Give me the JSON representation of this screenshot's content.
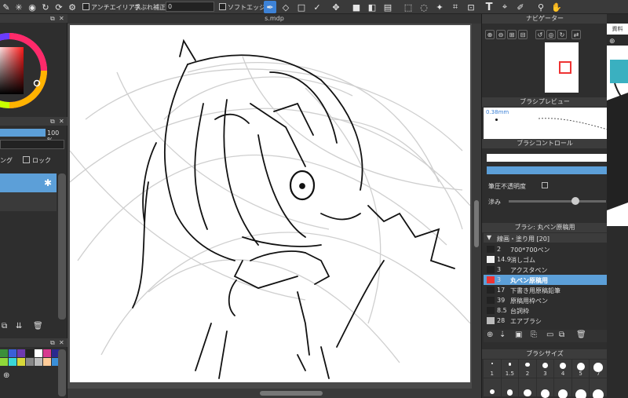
{
  "toolbar": {
    "antialias_label": "アンチエイリアス",
    "stabilizer_label": "手ぶれ補正",
    "stabilizer_value": "0",
    "soft_edge_label": "ソフトエッジ",
    "text_tool_glyph": "T"
  },
  "layer_panel": {
    "opacity_value": "100 %",
    "clipping_label": "ング",
    "lock_label": "ロック"
  },
  "document": {
    "tab_title": "s.mdp"
  },
  "navigator": {
    "title": "ナビゲーター"
  },
  "brush_preview": {
    "title": "ブラシプレビュー",
    "size_label": "0.38mm"
  },
  "brush_control": {
    "title": "ブラシコントロール",
    "pressure_opacity_label": "筆圧不透明度",
    "blur_label": "滲み"
  },
  "brush_list": {
    "title": "ブラシ: 丸ペン原稿用",
    "group_label": "線画・塗り用 [20]",
    "items": [
      {
        "size": "2",
        "name": "700*700ペン"
      },
      {
        "size": "14.9",
        "name": "消しゴム"
      },
      {
        "size": "3",
        "name": "アクスタペン"
      },
      {
        "size": "3",
        "name": "丸ペン原稿用"
      },
      {
        "size": "17",
        "name": "下書き用原稿鉛筆"
      },
      {
        "size": "39",
        "name": "原稿用枠ペン"
      },
      {
        "size": "8.5",
        "name": "台詞枠"
      },
      {
        "size": "28",
        "name": "エアブラシ"
      }
    ]
  },
  "brush_size": {
    "title": "ブラシサイズ",
    "sizes": [
      "1",
      "1.5",
      "2",
      "3",
      "4",
      "5",
      "7"
    ]
  },
  "reference": {
    "tab_label": "資料"
  },
  "colors": {
    "accent": "#3d82d6",
    "selected_row": "#5c9fd8",
    "panel_bg": "#2e2e2e"
  }
}
